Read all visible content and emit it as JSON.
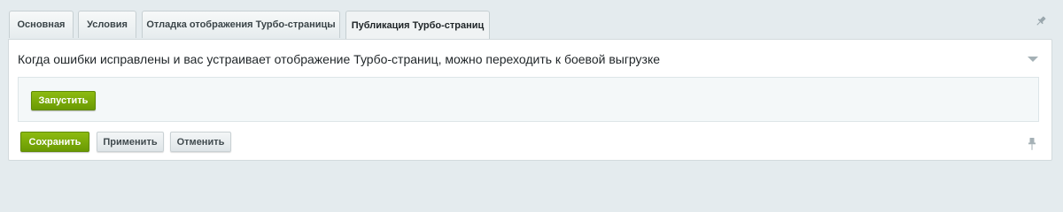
{
  "tabs": [
    {
      "label": "Основная",
      "active": false
    },
    {
      "label": "Условия",
      "active": false
    },
    {
      "label": "Отладка отображения Турбо-страницы",
      "active": false
    },
    {
      "label": "Публикация Турбо-страниц",
      "active": true
    }
  ],
  "section": {
    "title": "Когда ошибки исправлены и вас устраивает отображение Турбо-страниц, можно переходить к боевой выгрузке",
    "run_label": "Запустить"
  },
  "footer": {
    "save_label": "Сохранить",
    "apply_label": "Применить",
    "cancel_label": "Отменить"
  },
  "colors": {
    "background": "#e4ebee",
    "accent_green": "#7aab0a"
  },
  "icons": {
    "tab_pin": "pin-icon",
    "collapse": "collapse-arrow-icon",
    "footer_pin": "pin-icon"
  }
}
